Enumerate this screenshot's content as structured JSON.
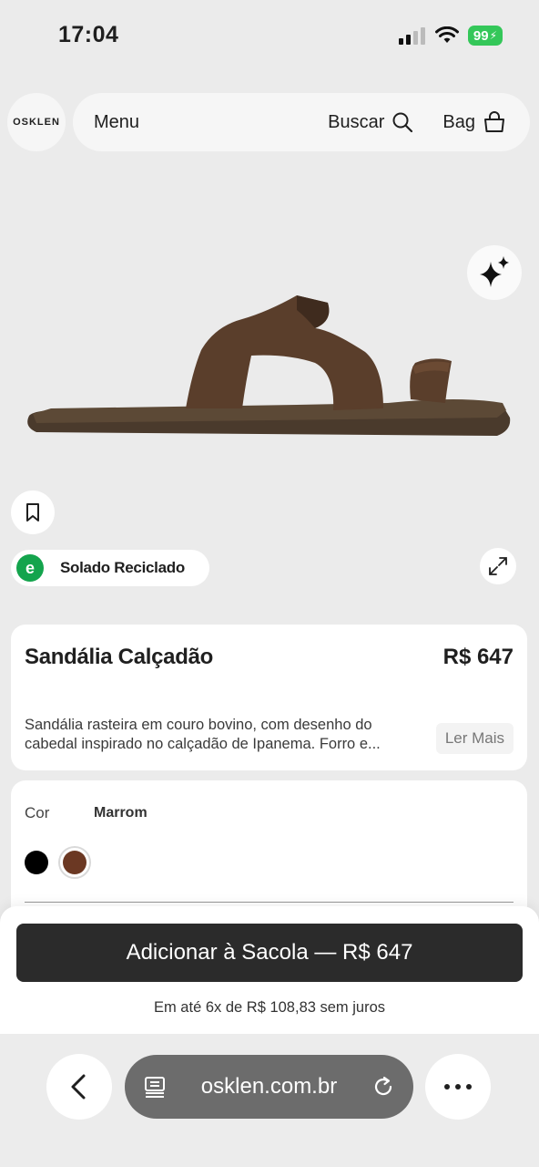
{
  "status_bar": {
    "time": "17:04",
    "battery": "99"
  },
  "header": {
    "logo": "OSKLEN",
    "menu_label": "Menu",
    "search_label": "Buscar",
    "bag_label": "Bag"
  },
  "badge": {
    "icon_letter": "e",
    "label": "Solado Reciclado"
  },
  "product": {
    "name": "Sandália Calçadão",
    "price": "R$ 647",
    "description": "Sandália rasteira em couro bovino, com desenho do cabedal inspirado no calçadão de Ipanema. Forro e...",
    "read_more": "Ler Mais"
  },
  "color": {
    "label": "Cor",
    "selected": "Marrom",
    "swatches": [
      "#000000",
      "#6b3823"
    ]
  },
  "cta": {
    "add_to_bag": "Adicionar à Sacola — R$ 647",
    "installments": "Em até 6x de R$ 108,83 sem juros"
  },
  "browser": {
    "url": "osklen.com.br"
  }
}
